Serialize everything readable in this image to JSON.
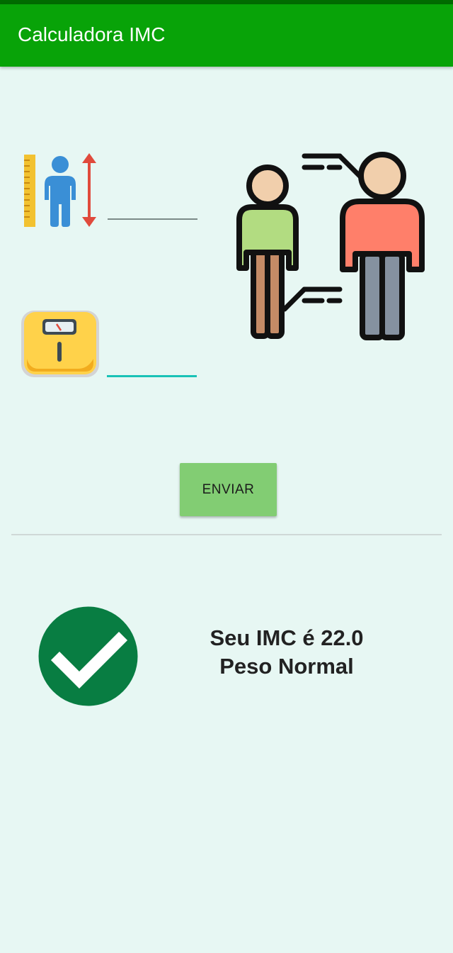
{
  "app_bar": {
    "title": "Calculadora IMC",
    "color": "#08a308",
    "status_color": "#006b00"
  },
  "form": {
    "height_icon": "person-height-icon",
    "height_value": "",
    "weight_icon": "bathroom-scale-icon",
    "weight_value": "",
    "illustration": "two-people-comparison-illustration",
    "submit_label": "ENVIAR",
    "submit_color": "#82cd73"
  },
  "result": {
    "icon": "check-circle-icon",
    "icon_color": "#087d42",
    "line1": "Seu IMC é 22.0",
    "line2": "Peso Normal"
  },
  "background": "#e7f7f3"
}
